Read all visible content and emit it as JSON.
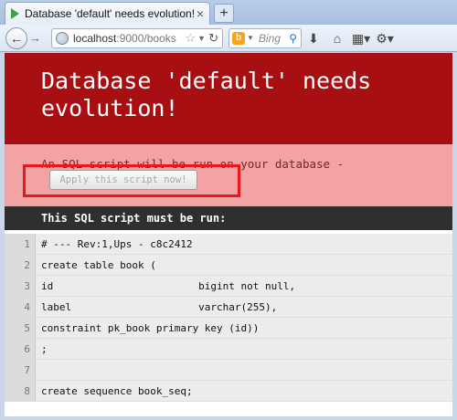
{
  "browser": {
    "tab_title": "Database 'default' needs evolution!",
    "tab_close": "×",
    "new_tab": "+",
    "url_host": "localhost",
    "url_path": ":9000/books",
    "search_placeholder": "Bing",
    "search_engine_letter": "b"
  },
  "page": {
    "heading": "Database 'default' needs evolution!",
    "subtext": "An SQL script will be run on your database -",
    "apply_button": "Apply this script now!",
    "sql_header": "This SQL script must be run:",
    "code_lines": [
      {
        "n": "1",
        "text": "# --- Rev:1,Ups - c8c2412"
      },
      {
        "n": "2",
        "text": "create table book ("
      },
      {
        "n": "3",
        "text": "id                        bigint not null,"
      },
      {
        "n": "4",
        "text": "label                     varchar(255),"
      },
      {
        "n": "5",
        "text": "constraint pk_book primary key (id))"
      },
      {
        "n": "6",
        "text": ";"
      },
      {
        "n": "7",
        "text": ""
      },
      {
        "n": "8",
        "text": "create sequence book_seq;"
      }
    ]
  },
  "colors": {
    "banner": "#a80f12",
    "subbanner": "#f4a3a5",
    "highlight_box": "#e8191c"
  }
}
